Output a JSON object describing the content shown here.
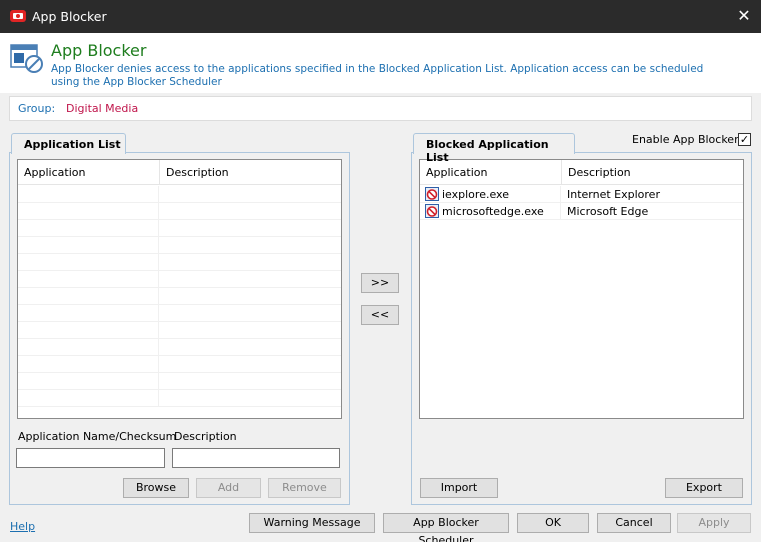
{
  "window": {
    "title": "App Blocker",
    "close_glyph": "✕"
  },
  "header": {
    "title": "App Blocker",
    "description": "App Blocker denies access to the applications specified in the Blocked Application List. Application access can be scheduled using the App Blocker Scheduler"
  },
  "group": {
    "label": "Group:",
    "value": "Digital Media"
  },
  "app_list": {
    "tab_label": "Application List",
    "columns": [
      "Application",
      "Description"
    ],
    "rows": [],
    "name_label": "Application Name/Checksum",
    "desc_label": "Description",
    "name_value": "",
    "desc_value": "",
    "browse_label": "Browse",
    "add_label": "Add",
    "remove_label": "Remove"
  },
  "transfer": {
    "add_all_label": ">>",
    "remove_all_label": "<<"
  },
  "blocked_list": {
    "tab_label": "Blocked Application List",
    "enable_label": "Enable App Blocker",
    "enable_checked": true,
    "columns": [
      "Application",
      "Description"
    ],
    "rows": [
      {
        "application": "iexplore.exe",
        "description": "Internet Explorer",
        "icon": "blocked-icon"
      },
      {
        "application": "microsoftedge.exe",
        "description": "Microsoft Edge",
        "icon": "blocked-icon"
      }
    ],
    "import_label": "Import",
    "export_label": "Export"
  },
  "footer": {
    "help_label": "Help",
    "warning_label": "Warning Message",
    "scheduler_label": "App Blocker Scheduler",
    "ok_label": "OK",
    "cancel_label": "Cancel",
    "apply_label": "Apply"
  },
  "colors": {
    "title_green": "#1e7d1e",
    "link_blue": "#1c6fb0",
    "group_value": "#c0154b",
    "titlebar": "#2b2b2b"
  }
}
